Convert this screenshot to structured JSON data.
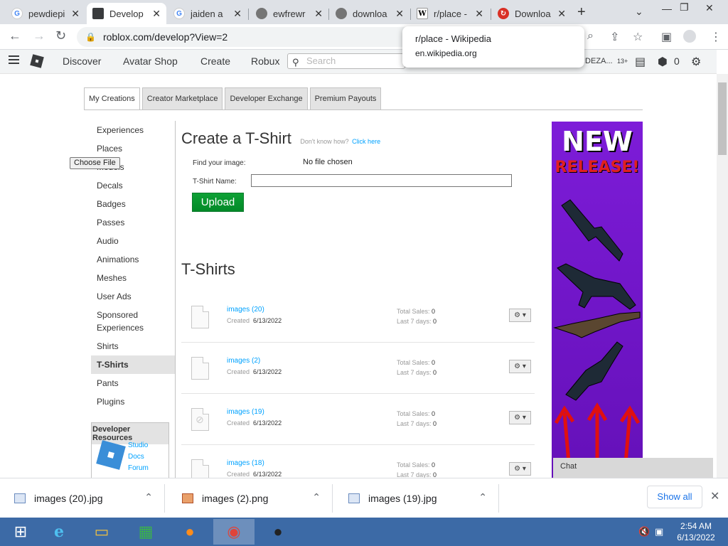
{
  "browser": {
    "tabs": [
      {
        "title": "pewdiepi",
        "icon": "google-icon",
        "active": false
      },
      {
        "title": "Develop",
        "icon": "roblox-icon",
        "active": true
      },
      {
        "title": "jaiden a",
        "icon": "google-icon",
        "active": false
      },
      {
        "title": "ewfrewr",
        "icon": "globe-icon",
        "active": false
      },
      {
        "title": "downloa",
        "icon": "globe-icon",
        "active": false
      },
      {
        "title": "r/place -",
        "icon": "wikipedia-icon",
        "active": false
      },
      {
        "title": "Downloa",
        "icon": "download-site-icon",
        "active": false
      }
    ],
    "url": "roblox.com/develop?View=2",
    "hovercard": {
      "title": "r/place - Wikipedia",
      "domain": "en.wikipedia.org"
    }
  },
  "header": {
    "nav": [
      "Discover",
      "Avatar Shop",
      "Create",
      "Robux"
    ],
    "search_placeholder": "Search",
    "username": "IDEZA...",
    "age": "13+",
    "robux": "0"
  },
  "page": {
    "tabs": [
      "My Creations",
      "Creator Marketplace",
      "Developer Exchange",
      "Premium Payouts"
    ],
    "leftnav": [
      "Experiences",
      "Places",
      "Models",
      "Decals",
      "Badges",
      "Passes",
      "Audio",
      "Animations",
      "Meshes",
      "User Ads",
      "Sponsored Experiences",
      "Shirts",
      "T-Shirts",
      "Pants",
      "Plugins"
    ],
    "devres": {
      "title": "Developer Resources",
      "links": [
        "Studio",
        "Docs",
        "Forum"
      ]
    },
    "create": {
      "title": "Create a T-Shirt",
      "help_text": "Don't know how?",
      "help_link": "Click here",
      "find_label": "Find your image:",
      "choose_button": "Choose File",
      "no_file": "No file chosen",
      "name_label": "T-Shirt Name:",
      "upload_button": "Upload"
    },
    "list_title": "T-Shirts",
    "items": [
      {
        "name": "images (20)",
        "created": "6/13/2022",
        "total_sales": "0",
        "last7": "0"
      },
      {
        "name": "images (2)",
        "created": "6/13/2022",
        "total_sales": "0",
        "last7": "0"
      },
      {
        "name": "images (19)",
        "created": "6/13/2022",
        "total_sales": "0",
        "last7": "0"
      },
      {
        "name": "images (18)",
        "created": "6/13/2022",
        "total_sales": "0",
        "last7": "0"
      }
    ],
    "labels": {
      "created": "Created",
      "total_sales": "Total Sales:",
      "last7": "Last 7 days:"
    },
    "ad": {
      "line1": "NEW",
      "line2": "RELEASE!"
    },
    "chat": "Chat"
  },
  "downloads": {
    "items": [
      "images (20).jpg",
      "images (2).png",
      "images (19).jpg"
    ],
    "show_all": "Show all"
  },
  "taskbar": {
    "time": "2:54 AM",
    "date": "6/13/2022"
  }
}
